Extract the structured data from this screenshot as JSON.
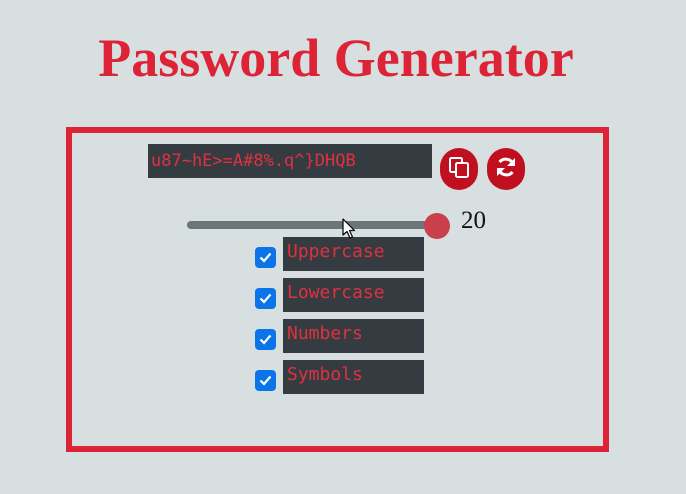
{
  "app": {
    "title": "Password Generator"
  },
  "password": {
    "value": "u87~hE>=A#8%.q^}DHQB"
  },
  "actions": {
    "copy_icon": "copy-icon",
    "refresh_icon": "refresh-icon"
  },
  "length": {
    "value": "20",
    "slider_fraction": 1.0
  },
  "options": [
    {
      "label": "Uppercase",
      "checked": true
    },
    {
      "label": "Lowercase",
      "checked": true
    },
    {
      "label": "Numbers",
      "checked": true
    },
    {
      "label": "Symbols",
      "checked": true
    }
  ],
  "colors": {
    "accent": "#dc2436",
    "button": "#c01020",
    "field_bg": "#343c42",
    "checkbox": "#0a74e8",
    "background": "#d8dfe0"
  }
}
